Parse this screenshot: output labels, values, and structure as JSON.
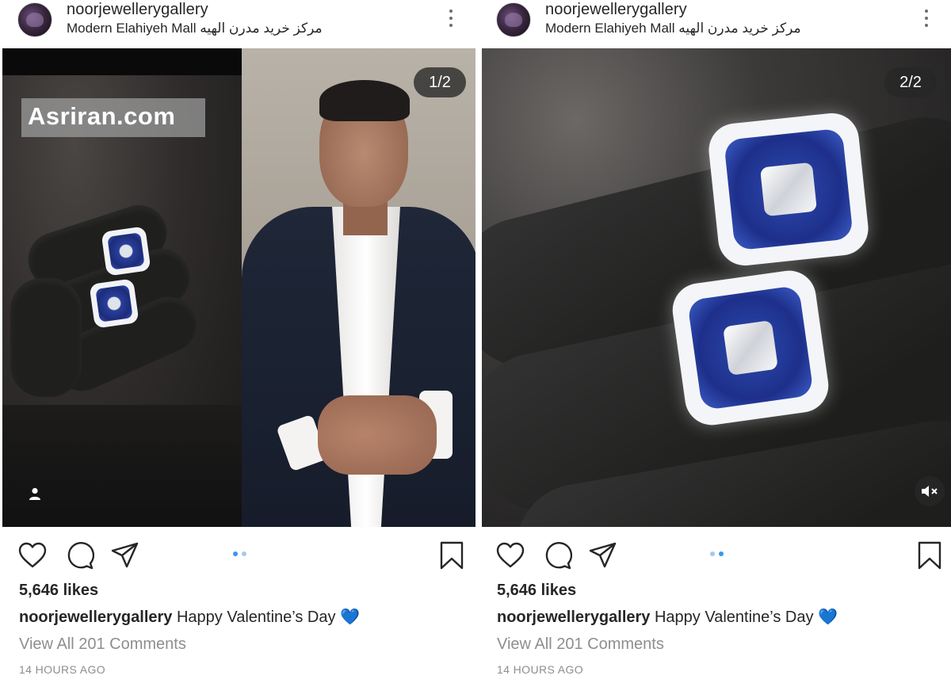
{
  "posts": [
    {
      "username": "noorjewellerygallery",
      "location": "Modern Elahiyeh Mall  مرکز خرید مدرن الهیه",
      "counter": "1/2",
      "watermark": "Asriran.com",
      "likes": "5,646 likes",
      "caption_user": "noorjewellerygallery",
      "caption_text": " Happy Valentine’s Day ",
      "caption_emoji": "💙",
      "comments": "View All 201 Comments",
      "time": "14 HOURS AGO",
      "active_dot": 0
    },
    {
      "username": "noorjewellerygallery",
      "location": "Modern Elahiyeh Mall  مرکز خرید مدرن الهیه",
      "counter": "2/2",
      "likes": "5,646 likes",
      "caption_user": "noorjewellerygallery",
      "caption_text": " Happy Valentine’s Day ",
      "caption_emoji": "💙",
      "comments": "View All 201 Comments",
      "time": "14 HOURS AGO",
      "active_dot": 1
    }
  ],
  "icons": {
    "like": "heart-outline-icon",
    "comment": "comment-bubble-icon",
    "share": "paper-plane-icon",
    "save": "bookmark-icon",
    "more": "three-dots-vertical-icon",
    "user_tag": "person-icon",
    "mute": "speaker-muted-icon"
  },
  "colors": {
    "text": "#262626",
    "secondary_text": "#8e8e8e",
    "active_dot": "#3897f0",
    "inactive_dot": "#a8c8e8",
    "heart_emoji": "#3d9df2"
  }
}
